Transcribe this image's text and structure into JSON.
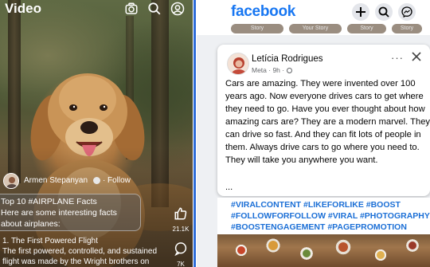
{
  "video": {
    "title": "Video",
    "header_icons": [
      "camera-icon",
      "search-icon",
      "profile-icon"
    ],
    "author": "Armen Stepanyan",
    "separator": "·",
    "follow": "Follow",
    "caption_line1": "Top 10 #AIRPLANE Facts",
    "caption_line2": "Here are some interesting facts",
    "caption_line3": "about airplanes:",
    "body_line1": "1. The First Powered Flight",
    "body_line2": "The first powered, controlled, and sustained",
    "body_line3": "flight was made by the Wright brothers on",
    "likes": "21.1K",
    "comments": "7K"
  },
  "facebook": {
    "logo": "facebook",
    "top_icons": [
      "plus-icon",
      "search-icon",
      "messenger-icon"
    ],
    "stories": [
      "Story",
      "Your Story",
      "Story",
      "Story"
    ],
    "post": {
      "author": "Letícia Rodrigues",
      "meta": "Meta · 9h ·",
      "more": "···",
      "lines": [
        "Cars are amazing. They were invented over 100",
        "years ago. Now everyone drives cars to get where",
        "they need to go. Have you ever thought about how",
        "amazing cars are? They are a modern marvel. They",
        "can drive so fast. And they can fit lots of people in",
        "them. Always drive cars to go where you need to.",
        "They will take you anywhere you want."
      ],
      "ellipsis": "..."
    },
    "hashtags": [
      "#VIRALCONTENT #LIKEFORLIKE #BOOST",
      "#FOLLOWFORFOLLOW #VIRAL #PHOTOGRAPHY",
      "#BOOSTENGAGEMENT #PAGEPROMOTION"
    ]
  },
  "colors": {
    "fb_blue": "#1877f2",
    "hashtag_blue": "#1b6fd6",
    "divider_blue": "#2d6cd8"
  }
}
